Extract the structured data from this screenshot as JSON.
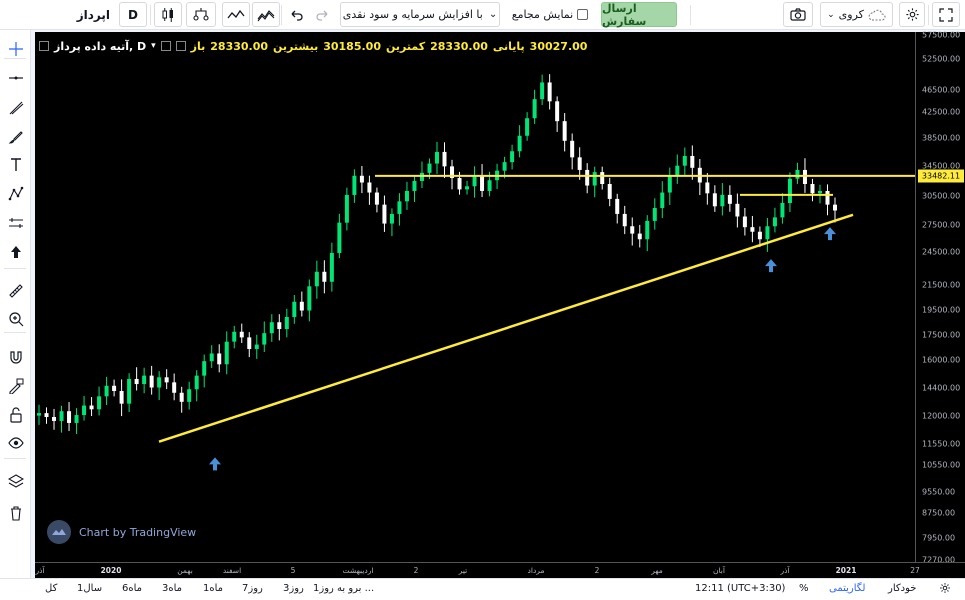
{
  "toolbar": {
    "fullscreen_icon": "expand-icon",
    "settings_icon": "gear-icon",
    "layout_label": "کروی",
    "camera_icon": "camera-icon",
    "send_order_label": "ارسال سفارش",
    "show_totals_label": "نمایش مجامع",
    "adjustment_label": "با افزایش سرمایه و سود نقدی",
    "undo_icon": "undo-icon",
    "redo_icon": "redo-icon",
    "indicators_icon": "indicators-icon",
    "compare_icon": "compare-icon",
    "bars_icon": "candles-icon",
    "interval_label": "D",
    "symbol_label": "اپرداز"
  },
  "legend": {
    "symbol": "آتیه داده پرداز, D",
    "open_label": "باز",
    "open_value": "28330.00",
    "high_label": "بیشترین",
    "high_value": "30185.00",
    "low_label": "کمترین",
    "low_value": "28330.00",
    "close_label": "پایانی",
    "close_value": "30027.00"
  },
  "watermark": "Chart by TradingView",
  "price_axis": {
    "ticks": [
      "57500.00",
      "52500.00",
      "46500.00",
      "42500.00",
      "38500.00",
      "34500.00",
      "30500.00",
      "27500.00",
      "24500.00",
      "21500.00",
      "19500.00",
      "17500.00",
      "16000.00",
      "14400.00",
      "12000.00",
      "11550.00",
      "10550.00",
      "9550.00",
      "8750.00",
      "7950.00",
      "7270.00"
    ],
    "last_price": "33482.11"
  },
  "time_axis": {
    "ticks": [
      "آذر",
      "2020",
      "بهمن",
      "اسفند",
      "5",
      "اردیبهشت",
      "2",
      "تیر",
      "مرداد",
      "2",
      "مهر",
      "آبان",
      "آذر",
      "2021",
      "27"
    ]
  },
  "bottom_bar": {
    "ranges": [
      "کل",
      "1سال",
      "6ماه",
      "3ماه",
      "1ماه",
      "7روز",
      "3روز",
      "1روز"
    ],
    "goto_label": "برو به ...",
    "time_label": "12:11 (UTC+3:30)",
    "percent_label": "%",
    "log_label": "لگاریتمی",
    "auto_label": "خودکار",
    "settings_icon": "gear-icon"
  },
  "left_tools": [
    "crosshair-icon",
    "horizontal-line-icon",
    "trend-line-icon",
    "brush-icon",
    "text-icon",
    "pattern-icon",
    "measure-icon",
    "arrow-up-icon",
    "ruler-icon",
    "zoom-icon",
    "magnet-icon",
    "lock-drawing-icon",
    "lock-icon",
    "eye-icon",
    "layers-icon",
    "trash-icon"
  ],
  "colors": {
    "up": "#00e676",
    "down": "#ffffff",
    "trendline": "#ffeb3b",
    "arrow": "#4a90d9",
    "background": "#000000"
  },
  "chart_data": {
    "type": "candlestick",
    "title": "آتیه داده پرداز, D",
    "scale": "log",
    "ylim": [
      7000,
      60000
    ],
    "close_series": [
      12800,
      12600,
      12400,
      12900,
      12300,
      12700,
      13200,
      13000,
      13700,
      14300,
      14000,
      13300,
      14700,
      14400,
      14900,
      14200,
      14800,
      14500,
      13900,
      13400,
      14100,
      14900,
      15800,
      16300,
      15600,
      17100,
      17800,
      17400,
      16600,
      16900,
      17700,
      18500,
      18000,
      18900,
      20100,
      19400,
      21400,
      22700,
      21800,
      24500,
      27700,
      31000,
      33500,
      32600,
      31300,
      29800,
      27600,
      28700,
      30200,
      31500,
      32800,
      33900,
      35200,
      36900,
      34800,
      33200,
      31700,
      32100,
      33600,
      31500,
      32900,
      34200,
      35400,
      37000,
      39400,
      42300,
      45700,
      48900,
      45300,
      41800,
      38600,
      36100,
      34300,
      32200,
      34000,
      32400,
      30500,
      28700,
      27300,
      26500,
      25900,
      27900,
      29400,
      31300,
      33500,
      34900,
      36300,
      34600,
      32600,
      31200,
      29600,
      31000,
      29900,
      28400,
      27200,
      26700,
      25900,
      27300,
      28300,
      30000,
      33100,
      34300,
      32400,
      31200,
      31500,
      29800,
      29100
    ],
    "resistance_level": 33482.11,
    "support_trendline": [
      {
        "x": "2020 (early)",
        "y": 11400
      },
      {
        "x": "2021 (start)",
        "y": 28600
      }
    ],
    "annotations": [
      "arrow-up",
      "arrow-up",
      "arrow-up"
    ]
  }
}
